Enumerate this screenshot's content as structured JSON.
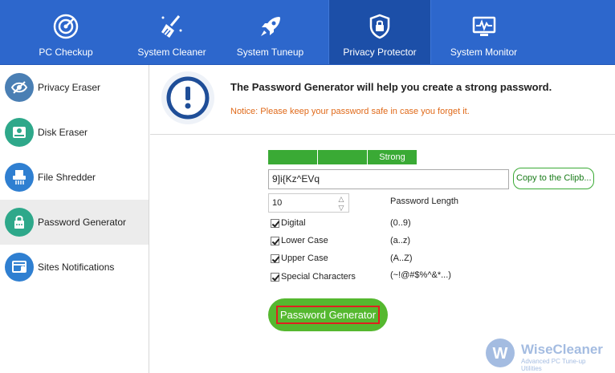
{
  "nav": {
    "tabs": [
      {
        "label": "PC Checkup",
        "icon": "radar-icon"
      },
      {
        "label": "System Cleaner",
        "icon": "broom-icon"
      },
      {
        "label": "System Tuneup",
        "icon": "rocket-icon"
      },
      {
        "label": "Privacy Protector",
        "icon": "shield-lock-icon",
        "active": true
      },
      {
        "label": "System Monitor",
        "icon": "monitor-pulse-icon"
      }
    ]
  },
  "sidebar": {
    "items": [
      {
        "label": "Privacy Eraser",
        "icon": "eye-slash-icon",
        "color": "#4a7fb4"
      },
      {
        "label": "Disk Eraser",
        "icon": "disk-icon",
        "color": "#2ea88a"
      },
      {
        "label": "File Shredder",
        "icon": "shredder-icon",
        "color": "#2f7fd1"
      },
      {
        "label": "Password Generator",
        "icon": "password-icon",
        "color": "#2ea88a",
        "active": true
      },
      {
        "label": "Sites Notifications",
        "icon": "notification-icon",
        "color": "#2f7fd1"
      }
    ]
  },
  "header": {
    "title": "The Password Generator will help you create a strong password.",
    "notice": "Notice: Please keep your password safe in case you forget it."
  },
  "generator": {
    "strength_label": "Strong",
    "password": "9]i{Kz^EVq",
    "copy_label": "Copy to the Clipb...",
    "length": "10",
    "length_label": "Password Length",
    "options": [
      {
        "label": "Digital",
        "range": "(0..9)",
        "checked": true
      },
      {
        "label": "Lower Case",
        "range": "(a..z)",
        "checked": true
      },
      {
        "label": "Upper Case",
        "range": "(A..Z)",
        "checked": true
      },
      {
        "label": "Special Characters",
        "range": "(~!@#$%^&*...)",
        "checked": true
      }
    ],
    "generate_label": "Password Generator"
  },
  "brand": {
    "name": "WiseCleaner",
    "tagline": "Advanced PC Tune-up Utilities"
  },
  "colors": {
    "nav_bg": "#2d67cc",
    "accent_green": "#3aaa35",
    "notice_orange": "#e06a1a"
  }
}
